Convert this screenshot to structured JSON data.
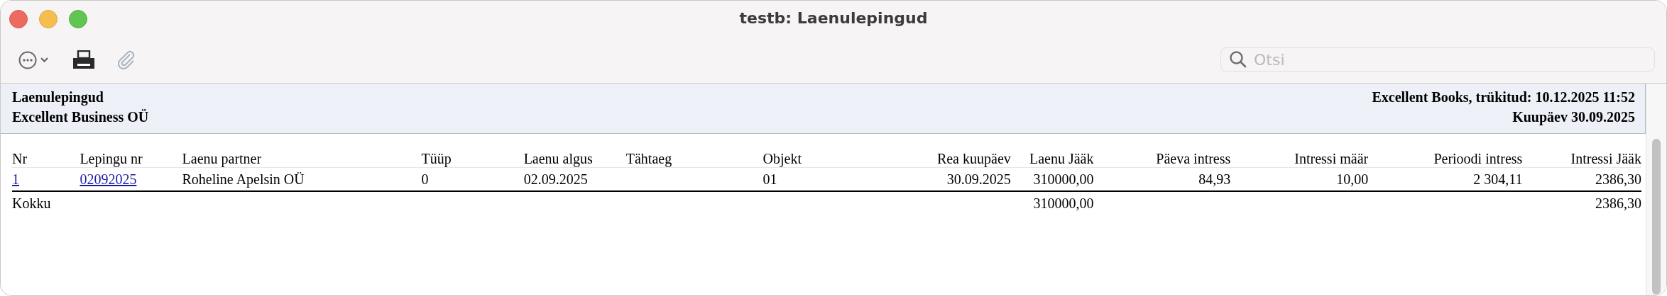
{
  "window": {
    "title": "testb: Laenulepingud"
  },
  "toolbar": [
    {
      "kind": "more",
      "disabled": false
    },
    {
      "kind": "print",
      "disabled": false
    },
    {
      "kind": "attach",
      "disabled": true
    }
  ],
  "search": {
    "placeholder": "Otsi"
  },
  "report_header": {
    "left": [
      "Laenulepingud",
      "Excellent Business OÜ"
    ],
    "right": [
      "Excellent Books, trükitud: 10.12.2025 11:52",
      "Kuupäev 30.09.2025"
    ]
  },
  "table": {
    "columns": [
      "Nr",
      "Lepingu nr",
      "Laenu partner",
      "Tüüp",
      "Laenu algus",
      "Tähtaeg",
      "Objekt",
      "Rea kuupäev",
      "Laenu Jääk",
      "Päeva intress",
      "Intressi määr",
      "Perioodi intress",
      "Intressi Jääk"
    ],
    "rows": [
      {
        "cells": [
          {
            "text": "1",
            "link": true
          },
          {
            "text": "02092025",
            "link": true
          },
          {
            "text": "Roheline Apelsin OÜ",
            "link": false
          },
          {
            "text": "0",
            "link": false
          },
          {
            "text": "02.09.2025",
            "link": false
          },
          null,
          {
            "text": "01",
            "link": false
          },
          {
            "text": "30.09.2025",
            "link": false
          },
          {
            "text": "310000,00",
            "link": false
          },
          {
            "text": "84,93",
            "link": false
          },
          {
            "text": "10,00",
            "link": false
          },
          {
            "text": "2 304,11",
            "link": false
          },
          {
            "text": "2386,30",
            "link": false
          }
        ]
      }
    ],
    "totals": {
      "label": "Kokku",
      "laenu_jaak": "310000,00",
      "intressi_jaak": "2386,30"
    }
  }
}
